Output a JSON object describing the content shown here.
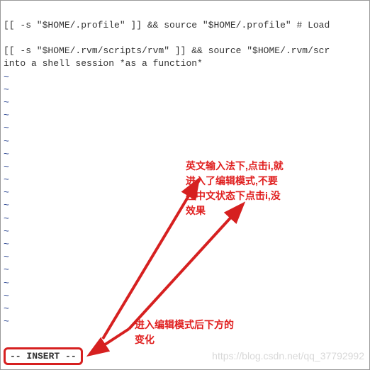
{
  "terminal": {
    "line1": "[[ -s \"$HOME/.profile\" ]] && source \"$HOME/.profile\" # Load",
    "line2": "[[ -s \"$HOME/.rvm/scripts/rvm\" ]] && source \"$HOME/.rvm/scr",
    "line3": "into a shell session *as a function*",
    "tilde": "~",
    "insert_mode": "-- INSERT --"
  },
  "annotations": {
    "note1": "英文输入法下,点击i,就\n进入了编辑模式,不要\n在中文状态下点击i,没\n效果",
    "note2": "进入编辑模式后下方的\n变化"
  },
  "watermark": "https://blog.csdn.net/qq_37792992",
  "colors": {
    "arrow": "#d62020",
    "tilde": "#1e3a8a"
  }
}
